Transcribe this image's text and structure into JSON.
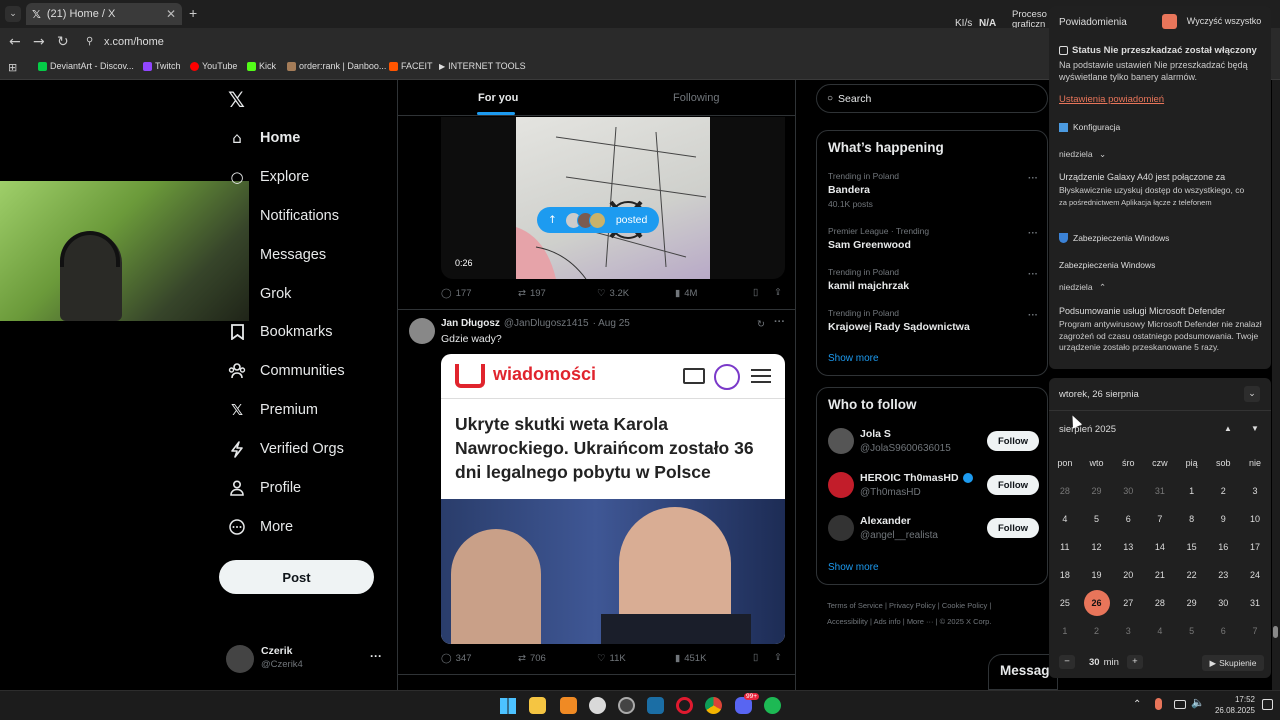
{
  "browser": {
    "tab_title": "(21) Home / X",
    "new_tab": "+",
    "url": "x.com/home",
    "bookmarks": [
      "DeviantArt - Discov...",
      "Twitch",
      "YouTube",
      "Kick",
      "order:rank | Danboo...",
      "FACEIT",
      "INTERNET TOOLS"
    ],
    "bookmark_colors": [
      "#05cc47",
      "#9146ff",
      "#ff0000",
      "#53fc18",
      "#a47c58",
      "#ff5500",
      "#dddddd"
    ]
  },
  "tray_top": {
    "speed_label": "KI/s",
    "speed_value": "N/A",
    "proc1": "Proceso",
    "proc2": "graficzn"
  },
  "sidebar": {
    "items": [
      {
        "label": "Home",
        "icon": "home-icon"
      },
      {
        "label": "Explore",
        "icon": "search-icon"
      },
      {
        "label": "Notifications",
        "icon": "bell-icon"
      },
      {
        "label": "Messages",
        "icon": "mail-icon"
      },
      {
        "label": "Grok",
        "icon": "grok-icon"
      },
      {
        "label": "Bookmarks",
        "icon": "bookmark-icon"
      },
      {
        "label": "Communities",
        "icon": "people-icon"
      },
      {
        "label": "Premium",
        "icon": "x-icon"
      },
      {
        "label": "Verified Orgs",
        "icon": "lightning-icon"
      },
      {
        "label": "Profile",
        "icon": "person-icon"
      },
      {
        "label": "More",
        "icon": "more-circle-icon"
      }
    ],
    "post_label": "Post",
    "user": {
      "name": "Czerik",
      "handle": "@Czerik4"
    }
  },
  "feed": {
    "tabs": [
      "For you",
      "Following"
    ],
    "posted_pill": "posted",
    "video_time": "0:26",
    "post1_stats": {
      "replies": "177",
      "reposts": "197",
      "likes": "3.2K",
      "views": "4M"
    },
    "post2": {
      "author": "Jan Długosz",
      "handle": "@JanDlugosz1415",
      "date": "· Aug 25",
      "text": "Gdzie wady?",
      "card_brand": "wiadomości",
      "card_headline": "Ukryte skutki weta Karola Nawrockiego. Ukraińcom zostało 36 dni legalnego pobytu w Polsce",
      "stats": {
        "replies": "347",
        "reposts": "706",
        "likes": "11K",
        "views": "451K"
      }
    }
  },
  "right": {
    "search_placeholder": "Search",
    "trends_title": "What’s happening",
    "trends": [
      {
        "cat": "Trending in Poland",
        "name": "Bandera",
        "posts": "40.1K posts"
      },
      {
        "cat": "Premier League · Trending",
        "name": "Sam Greenwood",
        "posts": ""
      },
      {
        "cat": "Trending in Poland",
        "name": "kamil majchrzak",
        "posts": ""
      },
      {
        "cat": "Trending in Poland",
        "name": "Krajowej Rady Sądownictwa",
        "posts": ""
      }
    ],
    "show_more": "Show more",
    "wtf_title": "Who to follow",
    "follow_label": "Follow",
    "suggestions": [
      {
        "name": "Jola S",
        "handle": "@JolaS9600636015",
        "color": "#555555"
      },
      {
        "name": "HEROIC Th0masHD",
        "handle": "@Th0masHD",
        "color": "#c21d2a"
      },
      {
        "name": "Alexander",
        "handle": "@angel__realista",
        "color": "#333333"
      }
    ],
    "footer": [
      "Terms of Service",
      "Privacy Policy",
      "Cookie Policy",
      "Accessibility",
      "Ads info",
      "More ···",
      "© 2025 X Corp."
    ],
    "messages_label": "Messag"
  },
  "notifications": {
    "title": "Powiadomienia",
    "clear_all": "Wyczyść wszystko",
    "dnd_title": "Status Nie przeszkadzać został włączony",
    "dnd_body": "Na podstawie ustawień Nie przeszkadzać będą wyświetlane tylko banery alarmów.",
    "settings_link": "Ustawienia powiadomień",
    "config_label": "Konfiguracja",
    "group1_day": "niedziela",
    "device_title": "Urządzenie Galaxy A40 jest połączone za",
    "device_body1": "Błyskawicznie uzyskuj dostęp do wszystkiego, co",
    "device_body2": "za pośrednictwem Aplikacja łącze z telefonem",
    "security_label": "Zabezpieczenia Windows",
    "security_label2": "Zabezpieczenia Windows",
    "group2_day": "niedziela",
    "defender_title": "Podsumowanie usługi Microsoft Defender",
    "defender_body": "Program antywirusowy Microsoft Defender nie znalazł zagrożeń od czasu ostatniego podsumowania. Twoje urządzenie zostało przeskanowane 5 razy."
  },
  "calendar": {
    "date_header": "wtorek, 26 sierpnia",
    "month": "sierpień 2025",
    "weekdays": [
      "pon",
      "wto",
      "śro",
      "czw",
      "pią",
      "sob",
      "nie"
    ],
    "weeks": [
      [
        "28",
        "29",
        "30",
        "31",
        "1",
        "2",
        "3"
      ],
      [
        "4",
        "5",
        "6",
        "7",
        "8",
        "9",
        "10"
      ],
      [
        "11",
        "12",
        "13",
        "14",
        "15",
        "16",
        "17"
      ],
      [
        "18",
        "19",
        "20",
        "21",
        "22",
        "23",
        "24"
      ],
      [
        "25",
        "26",
        "27",
        "28",
        "29",
        "30",
        "31"
      ],
      [
        "1",
        "2",
        "3",
        "4",
        "5",
        "6",
        "7"
      ]
    ],
    "selected": "26",
    "focus_minus": "−",
    "focus_value": "30",
    "focus_unit": "min",
    "focus_plus": "+",
    "focus_button": "Skupienie",
    "accent": "#e8755a"
  },
  "taskbar": {
    "time": "17:52",
    "date": "26.08.2025",
    "discord_badge": "99+"
  }
}
